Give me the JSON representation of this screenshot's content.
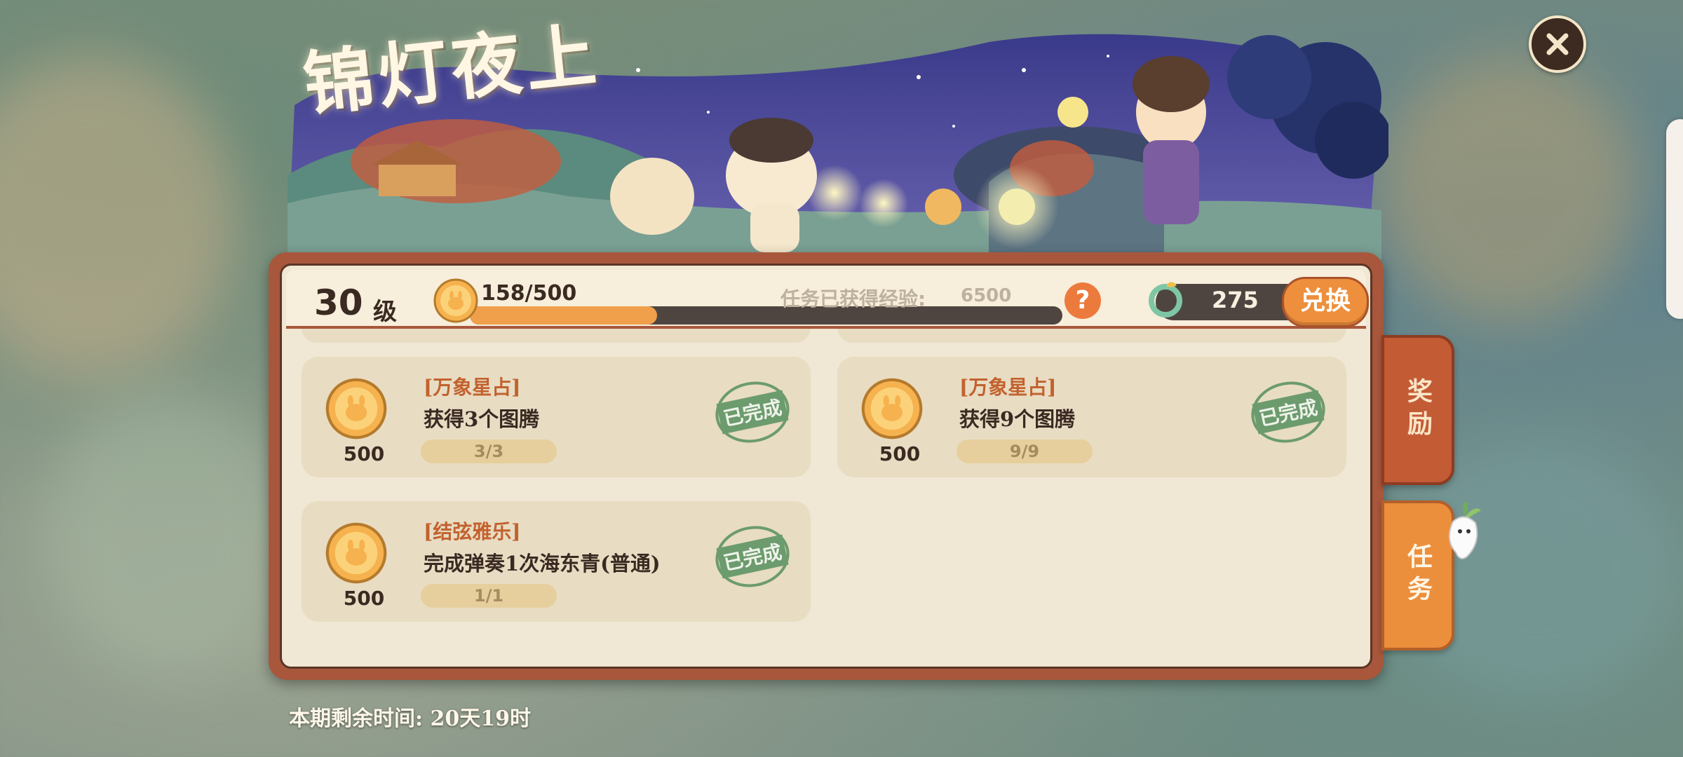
{
  "banner": {
    "title": "锦灯夜上"
  },
  "header": {
    "level_number": "30",
    "level_unit": "级",
    "exp_text": "158/500",
    "exp_progress": 0.316,
    "task_exp_label": "任务已获得经验:",
    "task_exp_value": "6500",
    "help_symbol": "?",
    "currency_amount": "275",
    "exchange_label": "兑换"
  },
  "tasks": [
    {
      "category": "[万象星占]",
      "name": "获得3个图腾",
      "progress": "3/3",
      "reward": "500",
      "stamp": "已完成"
    },
    {
      "category": "[万象星占]",
      "name": "获得9个图腾",
      "progress": "9/9",
      "reward": "500",
      "stamp": "已完成"
    },
    {
      "category": "[结弦雅乐]",
      "name": "完成弹奏1次海东青(普通)",
      "progress": "1/1",
      "reward": "500",
      "stamp": "已完成"
    }
  ],
  "side_tabs": {
    "reward_label": "奖励",
    "task_label": "任务"
  },
  "footer": {
    "remaining_time": "本期剩余时间: 20天19时"
  },
  "colors": {
    "panel_border": "#a8573c",
    "panel_bg": "#f0e7d4",
    "card_bg": "#e8dcc3",
    "accent_orange": "#ed8f3c",
    "category_color": "#c2622e",
    "stamp_green": "#6c9b6e"
  },
  "icons": {
    "close": "close-icon",
    "exp_coin": "experience-coin-icon",
    "currency": "jade-token-icon",
    "help": "help-icon",
    "mascot": "radish-mascot-icon"
  }
}
